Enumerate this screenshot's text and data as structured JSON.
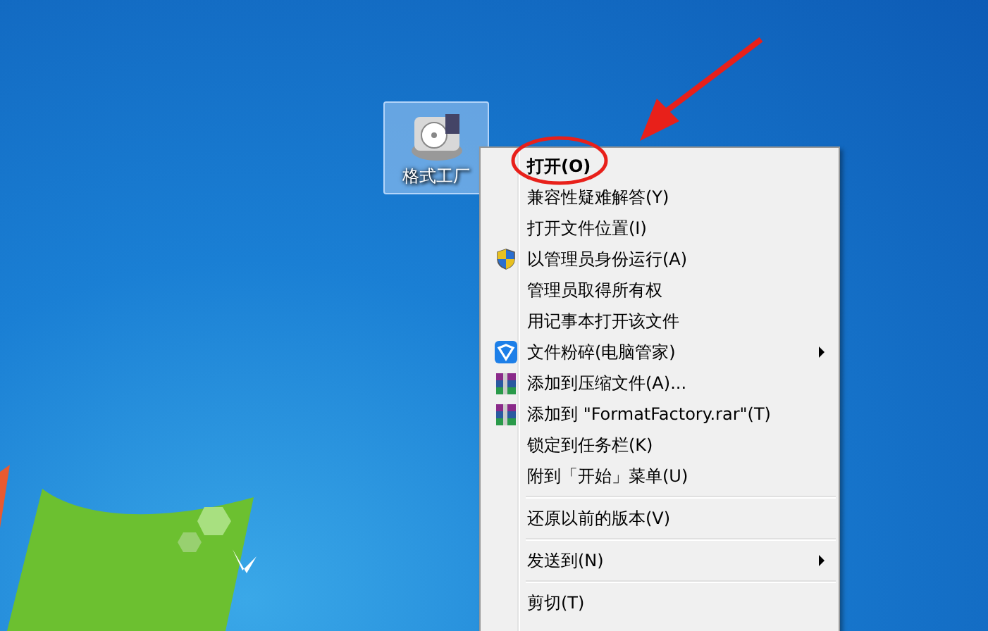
{
  "desktop_icon": {
    "label": "格式工厂",
    "selected": true
  },
  "context_menu": {
    "items": [
      {
        "kind": "plain",
        "label": "打开(O)",
        "default": true,
        "submenu": false
      },
      {
        "kind": "plain",
        "label": "兼容性疑难解答(Y)",
        "default": false,
        "submenu": false
      },
      {
        "kind": "plain",
        "label": "打开文件位置(I)",
        "default": false,
        "submenu": false
      },
      {
        "kind": "shield",
        "label": "以管理员身份运行(A)",
        "default": false,
        "submenu": false
      },
      {
        "kind": "plain",
        "label": "管理员取得所有权",
        "default": false,
        "submenu": false
      },
      {
        "kind": "plain",
        "label": "用记事本打开该文件",
        "default": false,
        "submenu": false
      },
      {
        "kind": "guard",
        "label": "文件粉碎(电脑管家)",
        "default": false,
        "submenu": true
      },
      {
        "kind": "archive",
        "label": "添加到压缩文件(A)...",
        "default": false,
        "submenu": false
      },
      {
        "kind": "archive",
        "label": "添加到 \"FormatFactory.rar\"(T)",
        "default": false,
        "submenu": false
      },
      {
        "kind": "plain",
        "label": "锁定到任务栏(K)",
        "default": false,
        "submenu": false
      },
      {
        "kind": "plain",
        "label": "附到「开始」菜单(U)",
        "default": false,
        "submenu": false
      },
      {
        "kind": "separator"
      },
      {
        "kind": "plain",
        "label": "还原以前的版本(V)",
        "default": false,
        "submenu": false
      },
      {
        "kind": "separator"
      },
      {
        "kind": "plain",
        "label": "发送到(N)",
        "default": false,
        "submenu": true
      },
      {
        "kind": "separator"
      },
      {
        "kind": "plain",
        "label": "剪切(T)",
        "default": false,
        "submenu": false
      }
    ]
  }
}
